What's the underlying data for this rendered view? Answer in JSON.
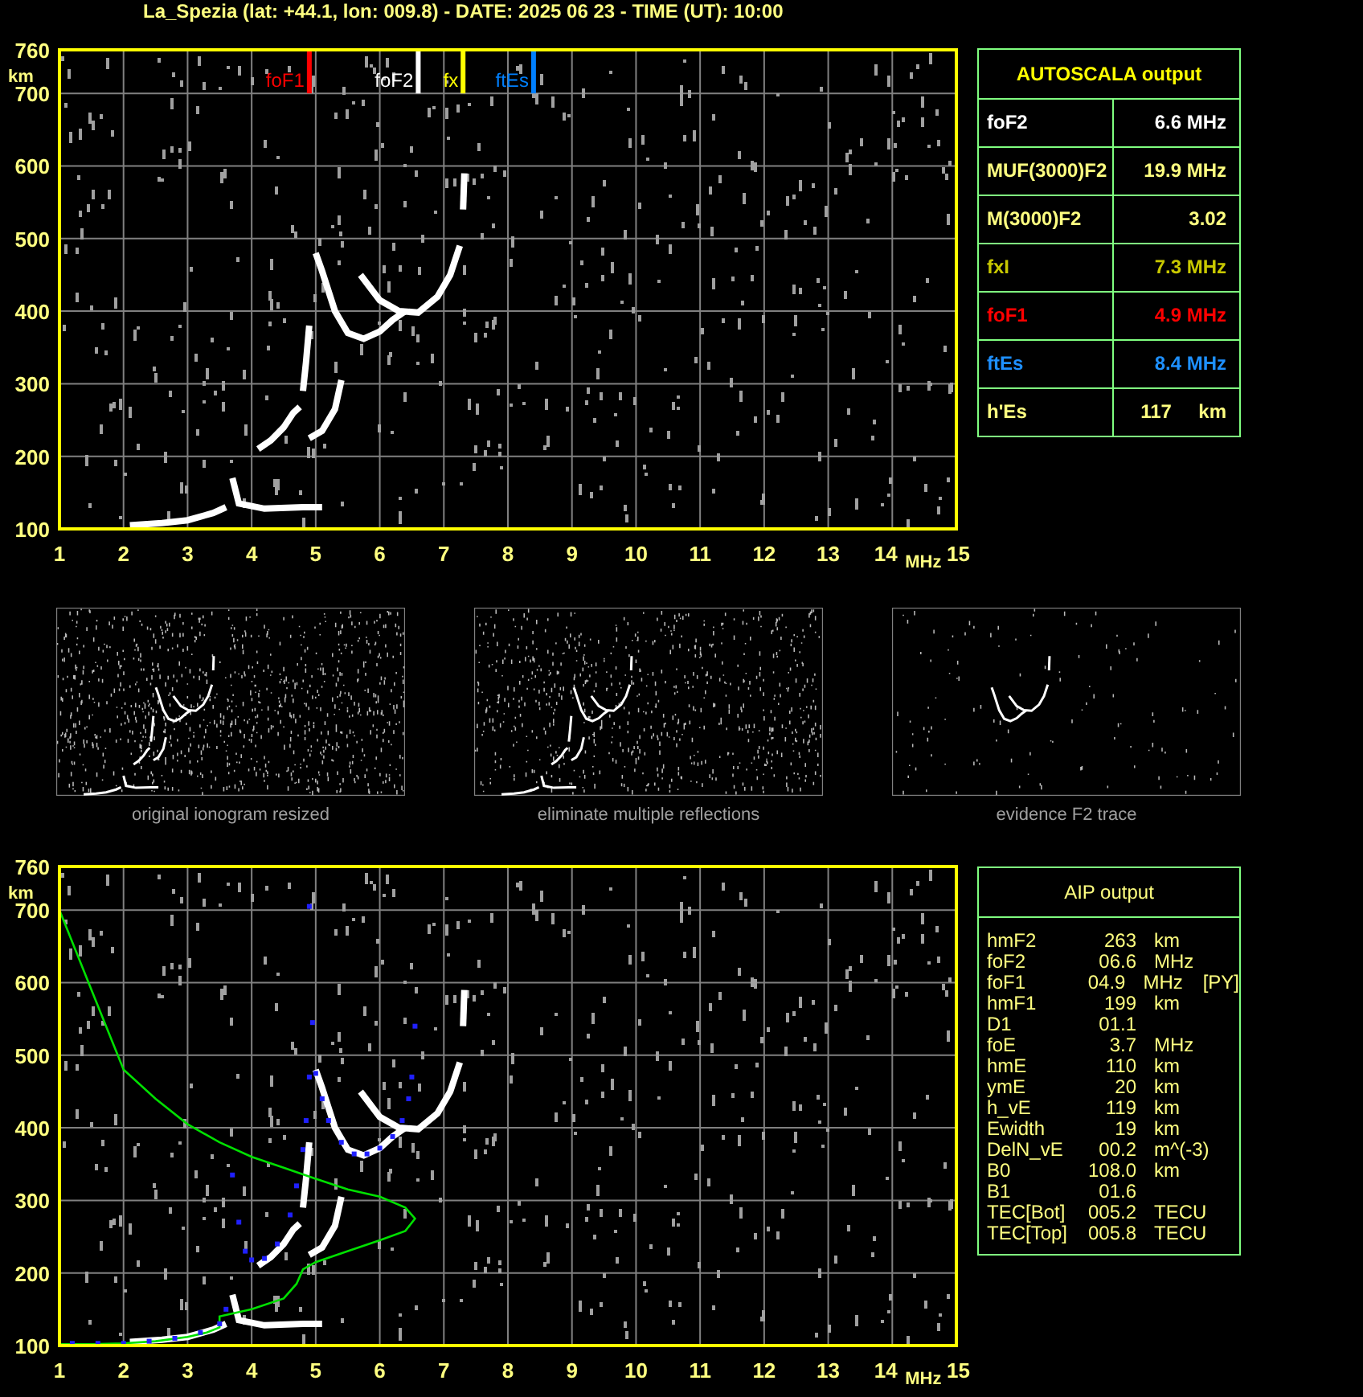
{
  "title": "La_Spezia (lat: +44.1, lon: 009.8) - DATE: 2025 06 23 - TIME (UT): 10:00",
  "ionograms": [
    {
      "kind": "scaled",
      "y_unit": "km",
      "y_ticks": [
        "760",
        "700",
        "600",
        "500",
        "400",
        "300",
        "200",
        "100"
      ],
      "x_unit": "MHz",
      "x_ticks": [
        "1",
        "2",
        "3",
        "4",
        "5",
        "6",
        "7",
        "8",
        "9",
        "10",
        "11",
        "12",
        "13",
        "14",
        "15"
      ],
      "markers": [
        {
          "label": "foF1",
          "color": "#ff0000"
        },
        {
          "label": "foF2",
          "color": "#ffffff"
        },
        {
          "label": "fx",
          "color": "#ffff00"
        },
        {
          "label": "ftEs",
          "color": "#0080ff"
        }
      ]
    },
    {
      "kind": "profile",
      "y_unit": "km",
      "y_ticks": [
        "760",
        "700",
        "600",
        "500",
        "400",
        "300",
        "200",
        "100"
      ],
      "x_unit": "MHz",
      "x_ticks": [
        "1",
        "2",
        "3",
        "4",
        "5",
        "6",
        "7",
        "8",
        "9",
        "10",
        "11",
        "12",
        "13",
        "14",
        "15"
      ]
    }
  ],
  "autoscala": {
    "title": "AUTOSCALA output",
    "rows": [
      {
        "name": "foF2",
        "value": "6.6 MHz",
        "color": "#ffffff"
      },
      {
        "name": "MUF(3000)F2",
        "value": "19.9 MHz",
        "color": "#ffff80"
      },
      {
        "name": "M(3000)F2",
        "value": "3.02",
        "color": "#ffff80"
      },
      {
        "name": "fxI",
        "value": "7.3 MHz",
        "color": "#c8c800"
      },
      {
        "name": "foF1",
        "value": "4.9 MHz",
        "color": "#ff0000"
      },
      {
        "name": "ftEs",
        "value": "8.4 MHz",
        "color": "#1e90ff"
      },
      {
        "name": "h'Es",
        "value": "117     km",
        "color": "#ffff80"
      }
    ]
  },
  "thumbnails": [
    {
      "kind": "raw",
      "caption": "original ionogram resized"
    },
    {
      "kind": "filtered",
      "caption": "eliminate multiple reflections"
    },
    {
      "kind": "f2",
      "caption": "evidence F2 trace"
    }
  ],
  "aip": {
    "title": "AIP output",
    "rows": [
      {
        "name": "hmF2",
        "value": "263",
        "unit": "km"
      },
      {
        "name": "foF2",
        "value": "06.6",
        "unit": "MHz"
      },
      {
        "name": "foF1",
        "value": "04.9",
        "unit": "MHz",
        "note": "[PY]"
      },
      {
        "name": "hmF1",
        "value": "199",
        "unit": "km"
      },
      {
        "name": "D1",
        "value": "01.1"
      },
      {
        "name": "foE",
        "value": "3.7",
        "unit": "MHz"
      },
      {
        "name": "hmE",
        "value": "110",
        "unit": "km"
      },
      {
        "name": "ymE",
        "value": "20",
        "unit": "km"
      },
      {
        "name": "h_vE",
        "value": "119",
        "unit": "km"
      },
      {
        "name": "Ewidth",
        "value": "19",
        "unit": "km"
      },
      {
        "name": "DelN_vE",
        "value": "00.2",
        "unit": "m^(-3)"
      },
      {
        "name": "B0",
        "value": "108.0",
        "unit": "km"
      },
      {
        "name": "B1",
        "value": "01.6"
      },
      {
        "name": "TEC[Bot]",
        "value": "005.2",
        "unit": "TECU"
      },
      {
        "name": "TEC[Top]",
        "value": "005.8",
        "unit": "TECU"
      }
    ]
  }
}
